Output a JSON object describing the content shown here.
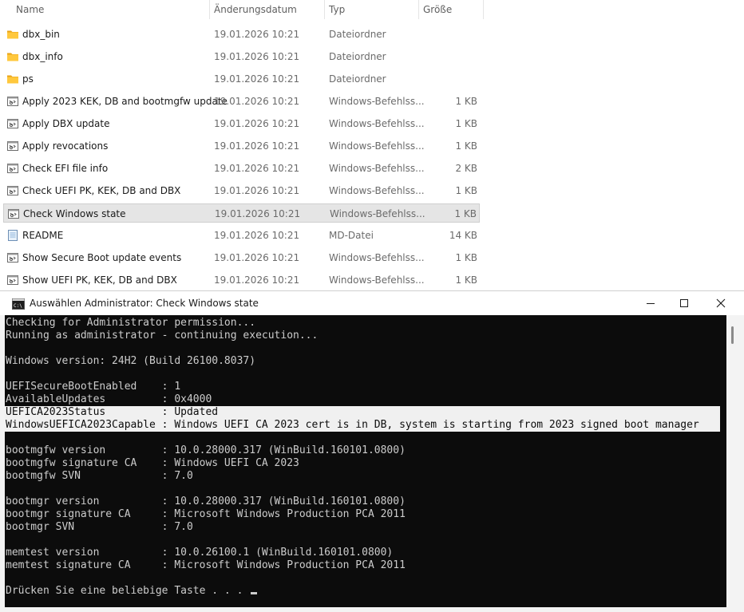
{
  "explorer": {
    "columns": {
      "name": "Name",
      "date": "Änderungsdatum",
      "type": "Typ",
      "size": "Größe"
    },
    "files": [
      {
        "name": "dbx_bin",
        "date": "19.01.2026 10:21",
        "type": "Dateiordner",
        "size": "",
        "icon": "folder-icon"
      },
      {
        "name": "dbx_info",
        "date": "19.01.2026 10:21",
        "type": "Dateiordner",
        "size": "",
        "icon": "folder-icon"
      },
      {
        "name": "ps",
        "date": "19.01.2026 10:21",
        "type": "Dateiordner",
        "size": "",
        "icon": "folder-icon"
      },
      {
        "name": "Apply 2023 KEK, DB and bootmgfw update",
        "date": "19.01.2026 10:21",
        "type": "Windows-Befehlss...",
        "size": "1 KB",
        "icon": "batch-file-icon"
      },
      {
        "name": "Apply DBX update",
        "date": "19.01.2026 10:21",
        "type": "Windows-Befehlss...",
        "size": "1 KB",
        "icon": "batch-file-icon"
      },
      {
        "name": "Apply revocations",
        "date": "19.01.2026 10:21",
        "type": "Windows-Befehlss...",
        "size": "1 KB",
        "icon": "batch-file-icon"
      },
      {
        "name": "Check EFI file info",
        "date": "19.01.2026 10:21",
        "type": "Windows-Befehlss...",
        "size": "2 KB",
        "icon": "batch-file-icon"
      },
      {
        "name": "Check UEFI PK, KEK, DB and DBX",
        "date": "19.01.2026 10:21",
        "type": "Windows-Befehlss...",
        "size": "1 KB",
        "icon": "batch-file-icon"
      },
      {
        "name": "Check Windows state",
        "date": "19.01.2026 10:21",
        "type": "Windows-Befehlss...",
        "size": "1 KB",
        "icon": "batch-file-icon",
        "selected": true
      },
      {
        "name": "README",
        "date": "19.01.2026 10:21",
        "type": "MD-Datei",
        "size": "14 KB",
        "icon": "text-file-icon"
      },
      {
        "name": "Show Secure Boot update events",
        "date": "19.01.2026 10:21",
        "type": "Windows-Befehlss...",
        "size": "1 KB",
        "icon": "batch-file-icon"
      },
      {
        "name": "Show UEFI PK, KEK, DB and DBX",
        "date": "19.01.2026 10:21",
        "type": "Windows-Befehlss...",
        "size": "1 KB",
        "icon": "batch-file-icon"
      }
    ]
  },
  "console": {
    "title": "Auswählen Administrator:  Check Windows state",
    "colors": {
      "background": "#0c0c0c",
      "text": "#cccccc",
      "highlight": "#f0f0f0"
    },
    "lines": [
      {
        "text": "Checking for Administrator permission..."
      },
      {
        "text": "Running as administrator - continuing execution..."
      },
      {
        "text": ""
      },
      {
        "text": "Windows version: 24H2 (Build 26100.8037)"
      },
      {
        "text": ""
      },
      {
        "text": "UEFISecureBootEnabled    : 1"
      },
      {
        "text": "AvailableUpdates         : 0x4000"
      },
      {
        "text": "UEFICA2023Status         : Updated",
        "highlight": true
      },
      {
        "text": "WindowsUEFICA2023Capable : Windows UEFI CA 2023 cert is in DB, system is starting from 2023 signed boot manager",
        "highlight": true
      },
      {
        "text": ""
      },
      {
        "text": "bootmgfw version         : 10.0.28000.317 (WinBuild.160101.0800)"
      },
      {
        "text": "bootmgfw signature CA    : Windows UEFI CA 2023"
      },
      {
        "text": "bootmgfw SVN             : 7.0"
      },
      {
        "text": ""
      },
      {
        "text": "bootmgr version          : 10.0.28000.317 (WinBuild.160101.0800)"
      },
      {
        "text": "bootmgr signature CA     : Microsoft Windows Production PCA 2011"
      },
      {
        "text": "bootmgr SVN              : 7.0"
      },
      {
        "text": ""
      },
      {
        "text": "memtest version          : 10.0.26100.1 (WinBuild.160101.0800)"
      },
      {
        "text": "memtest signature CA     : Microsoft Windows Production PCA 2011"
      },
      {
        "text": ""
      },
      {
        "text": "Drücken Sie eine beliebige Taste . . . ",
        "cursor": true
      }
    ]
  }
}
